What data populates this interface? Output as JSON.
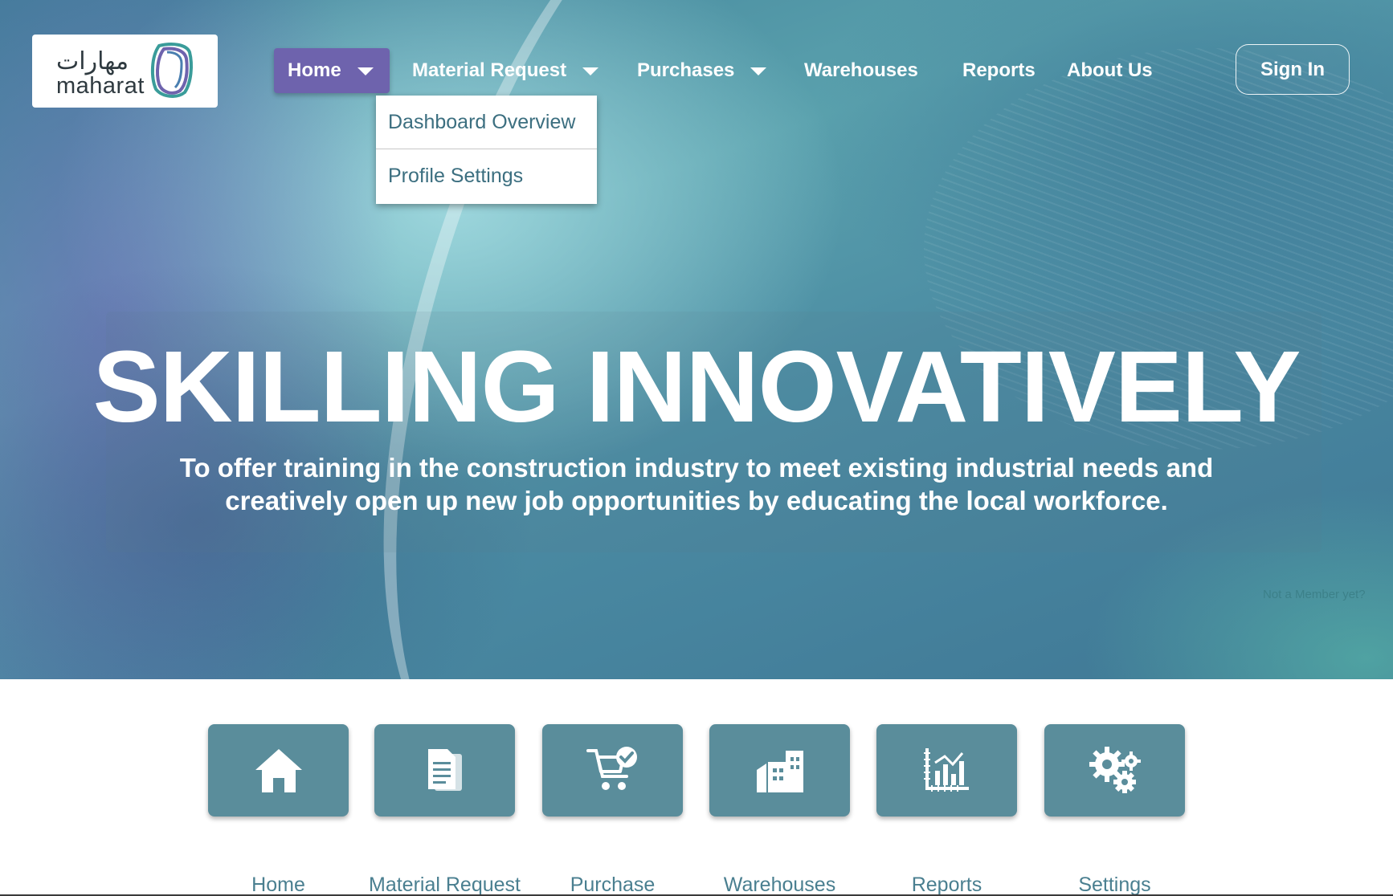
{
  "brand": {
    "logo_arabic": "مهارات",
    "logo_english": "maharat",
    "logo_colors": [
      "#6e63ad",
      "#3a9c9a"
    ]
  },
  "nav": {
    "items": [
      {
        "label": "Home",
        "has_dropdown": true,
        "active": true
      },
      {
        "label": "Material Request",
        "has_dropdown": true
      },
      {
        "label": "Purchases",
        "has_dropdown": true
      },
      {
        "label": "Warehouses"
      },
      {
        "label": "Reports"
      },
      {
        "label": "About Us"
      }
    ],
    "signin_label": "Sign In",
    "active_color": "#6e63ad"
  },
  "dropdown": {
    "items": [
      "Dashboard Overview",
      "Profile Settings"
    ]
  },
  "hero": {
    "title": "SKILLING INNOVATIVELY",
    "subtitle_line1": "To offer training in the construction industry to meet existing industrial needs and",
    "subtitle_line2": "creatively open up new job opportunities by educating the local workforce.",
    "not_member": "Not a Member yet?"
  },
  "tiles": [
    {
      "label": "Home",
      "icon": "home-icon"
    },
    {
      "label": "Material Request",
      "icon": "document-icon"
    },
    {
      "label": "Purchase",
      "icon": "cart-check-icon"
    },
    {
      "label": "Warehouses",
      "icon": "buildings-icon"
    },
    {
      "label": "Reports",
      "icon": "chart-icon"
    },
    {
      "label": "Settings",
      "icon": "gears-icon"
    }
  ],
  "colors": {
    "tile_bg": "#5a8d9b",
    "tile_label": "#4a7f90",
    "dropdown_text": "#3c6f80"
  }
}
